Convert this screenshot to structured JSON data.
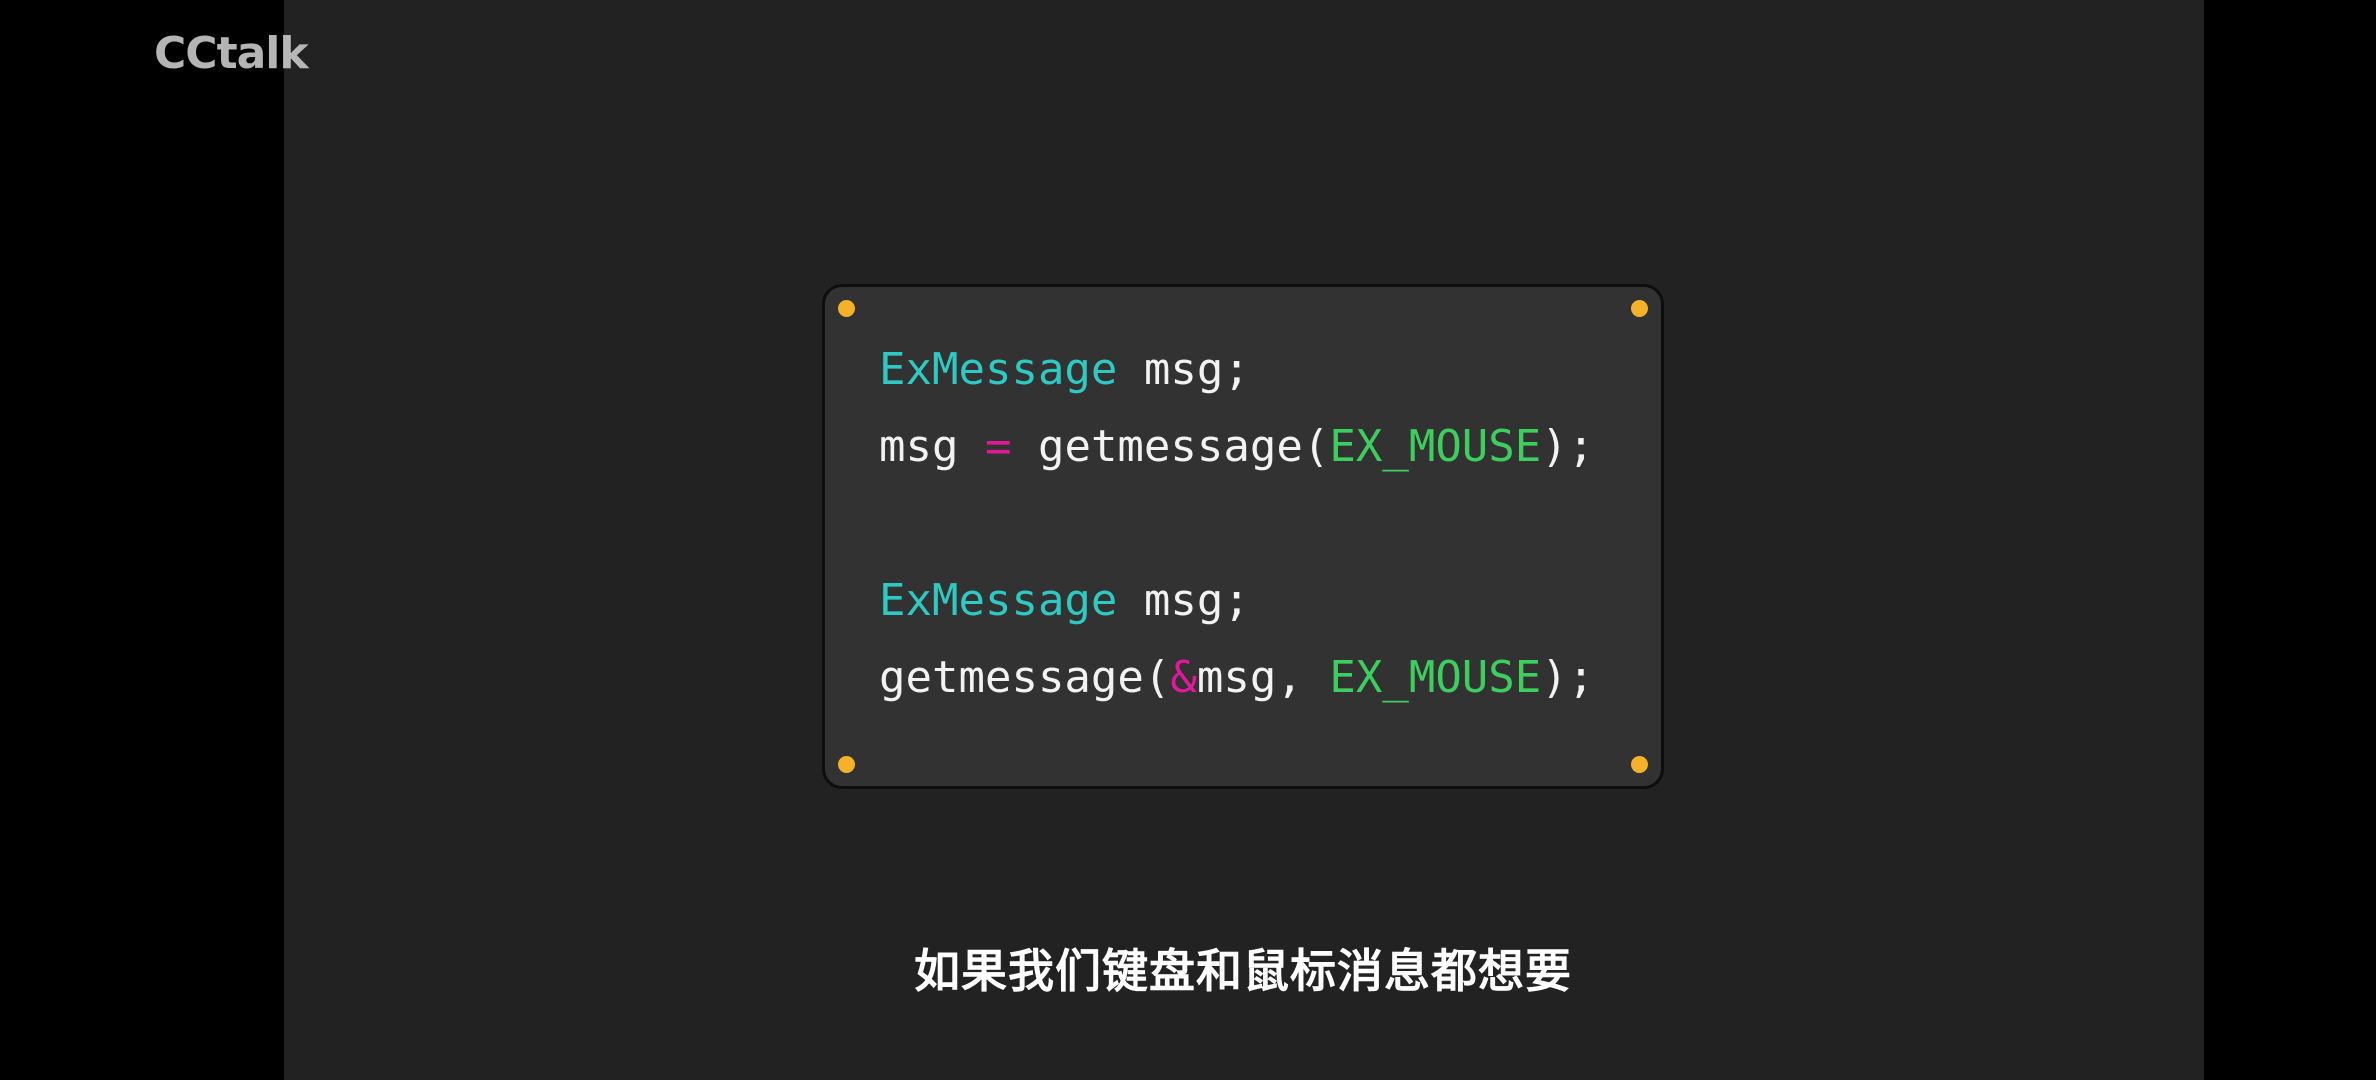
{
  "watermark": {
    "text": "CCtalk"
  },
  "code": {
    "lines": [
      [
        {
          "text": "ExMessage",
          "kind": "type"
        },
        {
          "text": " msg;",
          "kind": "plain"
        }
      ],
      [
        {
          "text": "msg ",
          "kind": "plain"
        },
        {
          "text": "=",
          "kind": "op"
        },
        {
          "text": " getmessage(",
          "kind": "plain"
        },
        {
          "text": "EX_MOUSE",
          "kind": "const"
        },
        {
          "text": ");",
          "kind": "plain"
        }
      ],
      [],
      [
        {
          "text": "ExMessage",
          "kind": "type"
        },
        {
          "text": " msg;",
          "kind": "plain"
        }
      ],
      [
        {
          "text": "getmessage(",
          "kind": "plain"
        },
        {
          "text": "&",
          "kind": "op"
        },
        {
          "text": "msg, ",
          "kind": "plain"
        },
        {
          "text": "EX_MOUSE",
          "kind": "const"
        },
        {
          "text": ");",
          "kind": "plain"
        }
      ]
    ]
  },
  "subtitle": {
    "text": "如果我们键盘和鼠标消息都想要"
  },
  "colors": {
    "background": "#222222",
    "card": "#323232",
    "corner_dot": "#f5b12a",
    "type": "#2ec9c2",
    "constant": "#3ccf5e",
    "operator": "#e0199b",
    "plain": "#f2f2f2"
  }
}
